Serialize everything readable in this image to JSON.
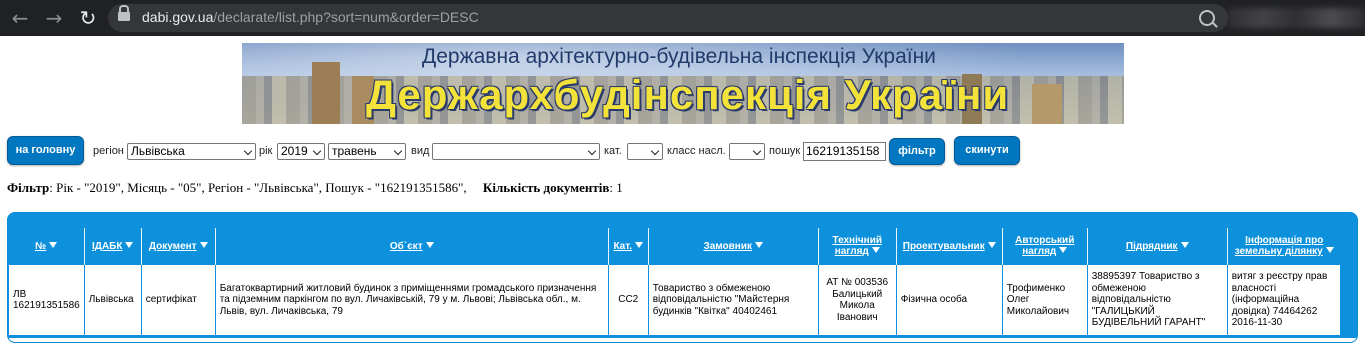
{
  "browser": {
    "url_host": "dabi.gov.ua",
    "url_path": "/declarate/list.php?sort=num&order=DESC"
  },
  "banner": {
    "subtitle": "Державна архітектурно-будівельна інспекція України",
    "title": "Держархбудінспекція України"
  },
  "filters": {
    "home_button": "на головну",
    "region_label": "регіон",
    "region_value": "Львівська",
    "year_label": "рік",
    "year_value": "2019",
    "month_value": "травень",
    "type_label": "вид",
    "type_value": "",
    "cat_label": "кат.",
    "cat_value": "",
    "class_label": "класс насл.",
    "class_value": "",
    "search_label": "пошук",
    "search_value": "16219135158",
    "filter_button": "фільтр",
    "reset_button": "скинути"
  },
  "summary": {
    "filter_label": "Фільтр",
    "filter_text": ": Рік - \"2019\", Місяць - \"05\", Регіон - \"Львівська\", Пошук - \"162191351586\",",
    "count_label": "Кількість документів",
    "count_value": ": 1"
  },
  "table": {
    "headers": [
      "№",
      "ІДАБК",
      "Документ",
      "Об`єкт",
      "Кат.",
      "Замовник",
      "Технічний нагляд",
      "Проектувальник",
      "Авторський нагляд",
      "Підрядник",
      "Інформація про земельну ділянку"
    ],
    "rows": [
      {
        "num": "ЛВ 162191351586",
        "idabk": "Львівська",
        "document": "сертифікат",
        "object": "Багатоквартирний житловий будинок з приміщеннями громадського призначення та підземним паркінгом по вул. Личаківській, 79 у м. Львові; Львівська обл., м. Львів, вул. Личаківська, 79",
        "cat": "СС2",
        "customer": "Товариство з обмеженою відповідальністю \"Майстерня будинків \"Квітка\" 40402461",
        "tech_supervision": "АТ № 003536 Балицький Микола Іванович",
        "designer": "Фізична особа",
        "author_supervision": "Трофименко Олег Миколайович",
        "contractor": "38895397 Товариство з обмеженою відповідальністю \"ГАЛИЦЬКИЙ БУДІВЕЛЬНИЙ ГАРАНТ\"",
        "land_info": "витяг з реєстру прав власності (інформаційна довідка) 74464262 2016-11-30"
      }
    ]
  }
}
